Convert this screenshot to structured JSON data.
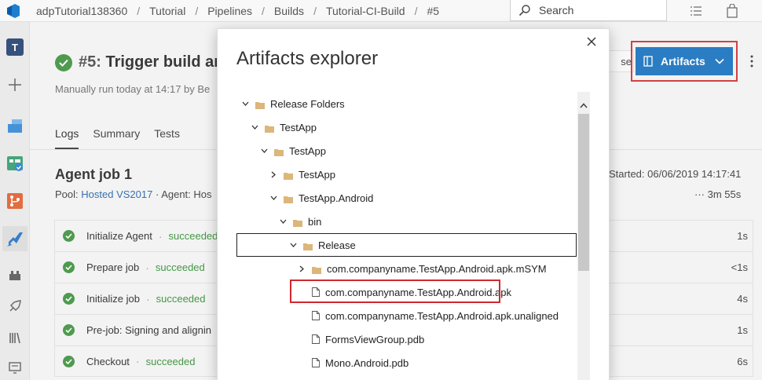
{
  "topbar": {
    "breadcrumbs": [
      "adpTutorial138360",
      "Tutorial",
      "Pipelines",
      "Builds",
      "Tutorial-CI-Build",
      "#5"
    ],
    "search_placeholder": "Search"
  },
  "leftnav": {
    "project_badge": "T",
    "items": [
      "add-icon",
      "overview-icon",
      "boards-icon",
      "repos-icon",
      "pipelines-icon",
      "test-plans-icon",
      "deployments-icon",
      "library-icon",
      "task-groups-icon"
    ]
  },
  "run": {
    "number": "#5:",
    "title": "Trigger build and",
    "subtitle": "Manually run today at 14:17 by Be"
  },
  "tabs": [
    "Logs",
    "Summary",
    "Tests"
  ],
  "job": {
    "title": "Agent job 1",
    "pool_label": "Pool:",
    "pool_link": "Hosted VS2017",
    "agent_label": "· Agent: Hos",
    "started": "Started: 06/06/2019 14:17:41",
    "duration": "··· 3m 55s"
  },
  "steps": [
    {
      "name": "Initialize Agent",
      "status": "succeeded",
      "duration": "1s"
    },
    {
      "name": "Prepare job",
      "status": "succeeded",
      "duration": "<1s"
    },
    {
      "name": "Initialize job",
      "status": "succeeded",
      "duration": "4s"
    },
    {
      "name": "Pre-job: Signing and alignin",
      "status": "",
      "duration": "1s"
    },
    {
      "name": "Checkout",
      "status": "succeeded",
      "duration": "6s"
    }
  ],
  "header_buttons": {
    "partial_button_text": "se",
    "artifacts_label": "Artifacts"
  },
  "dialog": {
    "title": "Artifacts explorer",
    "tree": [
      {
        "label": "Release Folders",
        "kind": "folder",
        "expanded": true
      },
      {
        "label": "TestApp",
        "kind": "folder",
        "expanded": true
      },
      {
        "label": "TestApp",
        "kind": "folder",
        "expanded": true
      },
      {
        "label": "TestApp",
        "kind": "folder",
        "expanded": false
      },
      {
        "label": "TestApp.Android",
        "kind": "folder",
        "expanded": true
      },
      {
        "label": "bin",
        "kind": "folder",
        "expanded": true
      },
      {
        "label": "Release",
        "kind": "folder",
        "expanded": true,
        "selected": true
      },
      {
        "label": "com.companyname.TestApp.Android.apk.mSYM",
        "kind": "folder",
        "expanded": false
      },
      {
        "label": "com.companyname.TestApp.Android.apk",
        "kind": "file",
        "highlighted": true
      },
      {
        "label": "com.companyname.TestApp.Android.apk.unaligned",
        "kind": "file"
      },
      {
        "label": "FormsViewGroup.pdb",
        "kind": "file"
      },
      {
        "label": "Mono.Android.pdb",
        "kind": "file"
      }
    ]
  },
  "colors": {
    "accent": "#106ebe",
    "success": "#3a8f3a",
    "highlight": "#d0282f",
    "folder": "#dcb67a"
  }
}
